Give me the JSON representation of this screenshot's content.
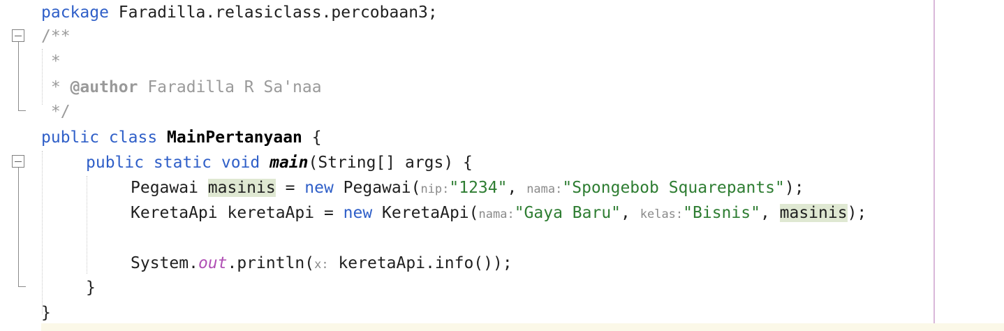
{
  "editor": {
    "lines": {
      "l1": {
        "kw": "package",
        "rest": " Faradilla.relasiclass.percobaan3;"
      },
      "l2": {
        "text": "/**"
      },
      "l3": {
        "text": " *"
      },
      "l4": {
        "prefix": " * ",
        "tag": "@author",
        "rest": " Faradilla R Sa'naa"
      },
      "l5": {
        "text": " */"
      },
      "l6": {
        "kw": "public class",
        "cls": "MainPertanyaan",
        "rest": " {"
      },
      "l7": {
        "kw": "public static void",
        "mth": "main",
        "rest": "(String[] args) {"
      },
      "l8": {
        "type": "Pegawai ",
        "var": "masinis",
        "eq": " = ",
        "kw": "new",
        "ctor": " Pegawai(",
        "hint1": "nip:",
        "str1": "\"1234\"",
        "sep": ", ",
        "hint2": "nama:",
        "str2": "\"Spongebob Squarepants\"",
        "end": ");"
      },
      "l9": {
        "decl": "KeretaApi keretaApi = ",
        "kw": "new",
        "ctor": " KeretaApi(",
        "hint1": "nama:",
        "str1": "\"Gaya Baru\"",
        "sep1": ", ",
        "hint2": "kelas:",
        "str2": "\"Bisnis\"",
        "sep2": ", ",
        "var": "masinis",
        "end": ");"
      },
      "l11": {
        "pre": "System.",
        "field": "out",
        "call": ".println(",
        "hint": "x:",
        "arg": " keretaApi.info());"
      },
      "l12": {
        "text": "}"
      },
      "l13": {
        "text": "}"
      }
    },
    "colors": {
      "keyword": "#2f5fc8",
      "comment": "#9a9a9a",
      "string": "#2e7d32",
      "static_field": "#b04fb4",
      "usage_highlight": "#dfe8d2",
      "right_margin": "#d9b8d9"
    },
    "icons": [
      "fold-collapse-icon"
    ]
  }
}
